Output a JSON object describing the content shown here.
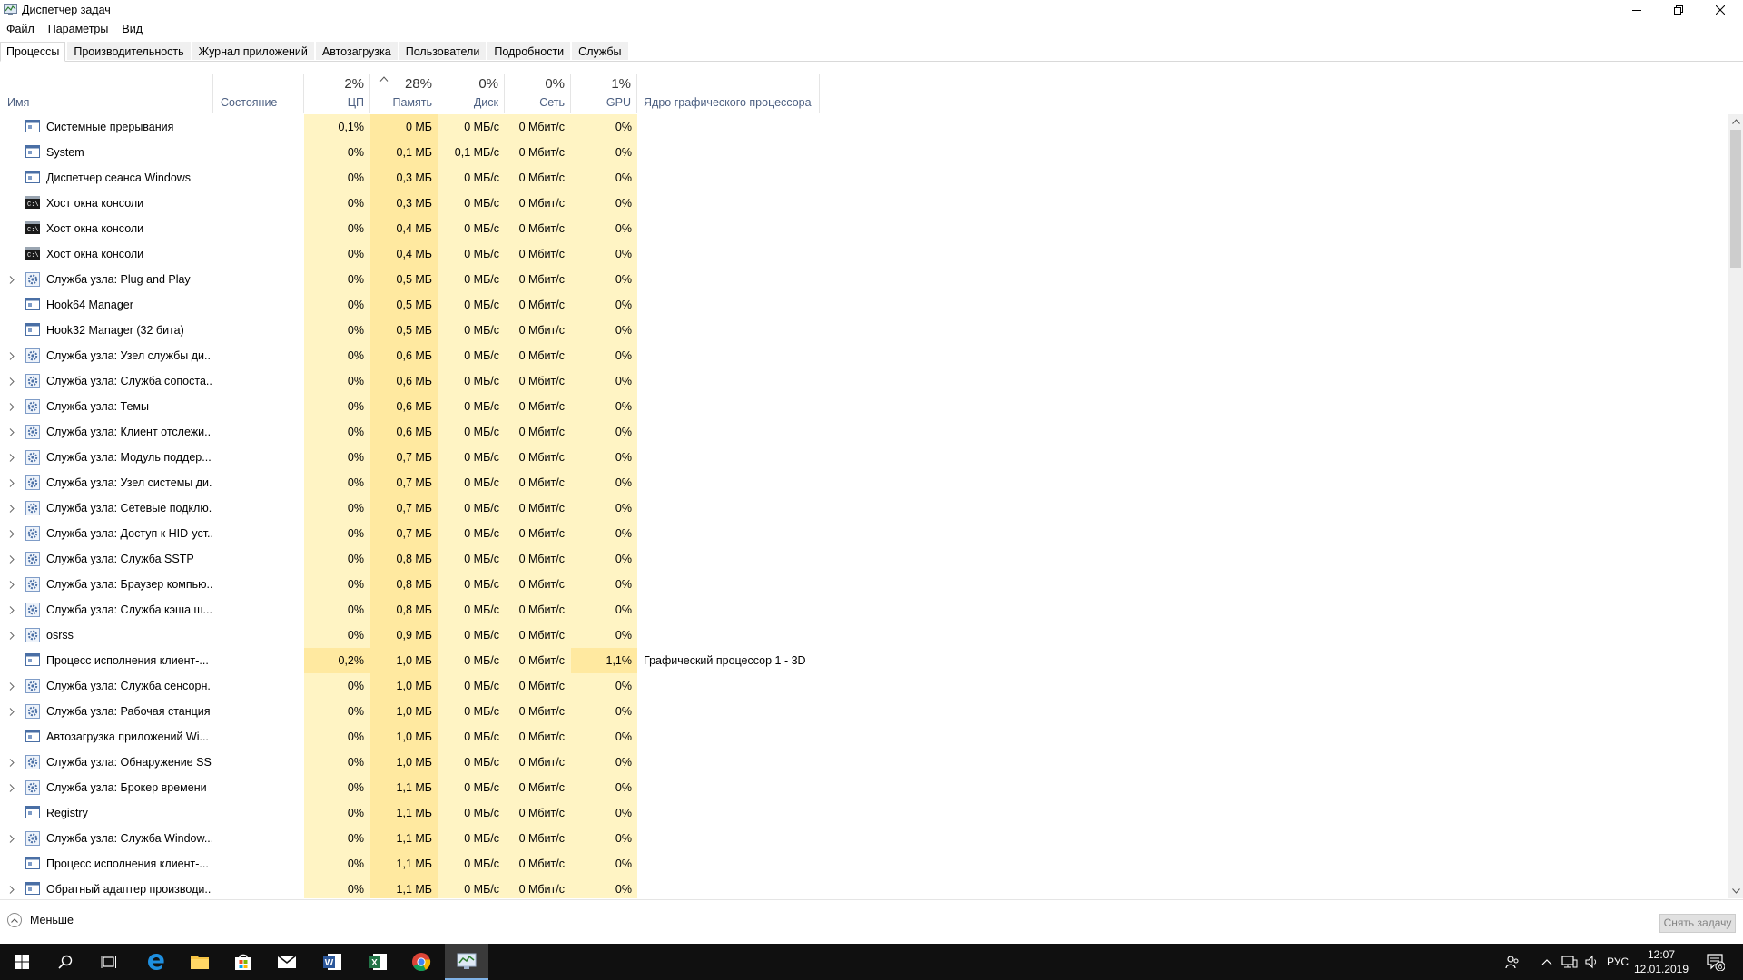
{
  "window": {
    "title": "Диспетчер задач",
    "minimize_icon": "minimize-icon",
    "maximize_icon": "restore-icon",
    "close_icon": "close-icon"
  },
  "menu": [
    "Файл",
    "Параметры",
    "Вид"
  ],
  "tabs": [
    "Процессы",
    "Производительность",
    "Журнал приложений",
    "Автозагрузка",
    "Пользователи",
    "Подробности",
    "Службы"
  ],
  "active_tab": "Процессы",
  "header": {
    "name": "Имя",
    "state": "Состояние",
    "cpu_pct": "2%",
    "cpu": "ЦП",
    "mem_pct": "28%",
    "mem": "Память",
    "disk_pct": "0%",
    "disk": "Диск",
    "net_pct": "0%",
    "net": "Сеть",
    "gpu_pct": "1%",
    "gpu": "GPU",
    "gpu_engine": "Ядро графического процессора"
  },
  "colors": {
    "heat_light": "#fff4c4",
    "heat_medium": "#ffe9a0",
    "header_label": "#4d6082",
    "taskbar": "#101010"
  },
  "processes": [
    {
      "name": "Системные прерывания",
      "icon": "app-window-icon",
      "expandable": false,
      "cpu": "0,1%",
      "mem": "0 МБ",
      "disk": "0 МБ/с",
      "net": "0 Мбит/с",
      "gpu": "0%",
      "engine": ""
    },
    {
      "name": "System",
      "icon": "app-window-icon",
      "expandable": false,
      "cpu": "0%",
      "mem": "0,1 МБ",
      "disk": "0,1 МБ/с",
      "net": "0 Мбит/с",
      "gpu": "0%",
      "engine": ""
    },
    {
      "name": "Диспетчер сеанса  Windows",
      "icon": "app-window-icon",
      "expandable": false,
      "cpu": "0%",
      "mem": "0,3 МБ",
      "disk": "0 МБ/с",
      "net": "0 Мбит/с",
      "gpu": "0%",
      "engine": ""
    },
    {
      "name": "Хост окна консоли",
      "icon": "console-icon",
      "expandable": false,
      "cpu": "0%",
      "mem": "0,3 МБ",
      "disk": "0 МБ/с",
      "net": "0 Мбит/с",
      "gpu": "0%",
      "engine": ""
    },
    {
      "name": "Хост окна консоли",
      "icon": "console-icon",
      "expandable": false,
      "cpu": "0%",
      "mem": "0,4 МБ",
      "disk": "0 МБ/с",
      "net": "0 Мбит/с",
      "gpu": "0%",
      "engine": ""
    },
    {
      "name": "Хост окна консоли",
      "icon": "console-icon",
      "expandable": false,
      "cpu": "0%",
      "mem": "0,4 МБ",
      "disk": "0 МБ/с",
      "net": "0 Мбит/с",
      "gpu": "0%",
      "engine": ""
    },
    {
      "name": "Служба узла: Plug and Play",
      "icon": "service-gear-icon",
      "expandable": true,
      "cpu": "0%",
      "mem": "0,5 МБ",
      "disk": "0 МБ/с",
      "net": "0 Мбит/с",
      "gpu": "0%",
      "engine": ""
    },
    {
      "name": "Hook64 Manager",
      "icon": "app-window-icon",
      "expandable": false,
      "cpu": "0%",
      "mem": "0,5 МБ",
      "disk": "0 МБ/с",
      "net": "0 Мбит/с",
      "gpu": "0%",
      "engine": ""
    },
    {
      "name": "Hook32 Manager (32 бита)",
      "icon": "app-window-icon",
      "expandable": false,
      "cpu": "0%",
      "mem": "0,5 МБ",
      "disk": "0 МБ/с",
      "net": "0 Мбит/с",
      "gpu": "0%",
      "engine": ""
    },
    {
      "name": "Служба узла: Узел службы ди...",
      "icon": "service-gear-icon",
      "expandable": true,
      "cpu": "0%",
      "mem": "0,6 МБ",
      "disk": "0 МБ/с",
      "net": "0 Мбит/с",
      "gpu": "0%",
      "engine": ""
    },
    {
      "name": "Служба узла: Служба сопоста...",
      "icon": "service-gear-icon",
      "expandable": true,
      "cpu": "0%",
      "mem": "0,6 МБ",
      "disk": "0 МБ/с",
      "net": "0 Мбит/с",
      "gpu": "0%",
      "engine": ""
    },
    {
      "name": "Служба узла: Темы",
      "icon": "service-gear-icon",
      "expandable": true,
      "cpu": "0%",
      "mem": "0,6 МБ",
      "disk": "0 МБ/с",
      "net": "0 Мбит/с",
      "gpu": "0%",
      "engine": ""
    },
    {
      "name": "Служба узла: Клиент отслежи...",
      "icon": "service-gear-icon",
      "expandable": true,
      "cpu": "0%",
      "mem": "0,6 МБ",
      "disk": "0 МБ/с",
      "net": "0 Мбит/с",
      "gpu": "0%",
      "engine": ""
    },
    {
      "name": "Служба узла: Модуль поддер...",
      "icon": "service-gear-icon",
      "expandable": true,
      "cpu": "0%",
      "mem": "0,7 МБ",
      "disk": "0 МБ/с",
      "net": "0 Мбит/с",
      "gpu": "0%",
      "engine": ""
    },
    {
      "name": "Служба узла: Узел системы ди...",
      "icon": "service-gear-icon",
      "expandable": true,
      "cpu": "0%",
      "mem": "0,7 МБ",
      "disk": "0 МБ/с",
      "net": "0 Мбит/с",
      "gpu": "0%",
      "engine": ""
    },
    {
      "name": "Служба узла: Сетевые подклю...",
      "icon": "service-gear-icon",
      "expandable": true,
      "cpu": "0%",
      "mem": "0,7 МБ",
      "disk": "0 МБ/с",
      "net": "0 Мбит/с",
      "gpu": "0%",
      "engine": ""
    },
    {
      "name": "Служба узла: Доступ к HID-уст...",
      "icon": "service-gear-icon",
      "expandable": true,
      "cpu": "0%",
      "mem": "0,7 МБ",
      "disk": "0 МБ/с",
      "net": "0 Мбит/с",
      "gpu": "0%",
      "engine": ""
    },
    {
      "name": "Служба узла: Служба SSTP",
      "icon": "service-gear-icon",
      "expandable": true,
      "cpu": "0%",
      "mem": "0,8 МБ",
      "disk": "0 МБ/с",
      "net": "0 Мбит/с",
      "gpu": "0%",
      "engine": ""
    },
    {
      "name": "Служба узла: Браузер компью...",
      "icon": "service-gear-icon",
      "expandable": true,
      "cpu": "0%",
      "mem": "0,8 МБ",
      "disk": "0 МБ/с",
      "net": "0 Мбит/с",
      "gpu": "0%",
      "engine": ""
    },
    {
      "name": "Служба узла: Служба кэша ш...",
      "icon": "service-gear-icon",
      "expandable": true,
      "cpu": "0%",
      "mem": "0,8 МБ",
      "disk": "0 МБ/с",
      "net": "0 Мбит/с",
      "gpu": "0%",
      "engine": ""
    },
    {
      "name": "osrss",
      "icon": "service-gear-icon",
      "expandable": true,
      "cpu": "0%",
      "mem": "0,9 МБ",
      "disk": "0 МБ/с",
      "net": "0 Мбит/с",
      "gpu": "0%",
      "engine": ""
    },
    {
      "name": "Процесс исполнения клиент-...",
      "icon": "app-window-icon",
      "expandable": false,
      "cpu": "0,2%",
      "mem": "1,0 МБ",
      "disk": "0 МБ/с",
      "net": "0 Мбит/с",
      "gpu": "1,1%",
      "engine": "Графический процессор 1 - 3D",
      "highlight": true
    },
    {
      "name": "Служба узла: Служба сенсорн...",
      "icon": "service-gear-icon",
      "expandable": true,
      "cpu": "0%",
      "mem": "1,0 МБ",
      "disk": "0 МБ/с",
      "net": "0 Мбит/с",
      "gpu": "0%",
      "engine": ""
    },
    {
      "name": "Служба узла: Рабочая станция",
      "icon": "service-gear-icon",
      "expandable": true,
      "cpu": "0%",
      "mem": "1,0 МБ",
      "disk": "0 МБ/с",
      "net": "0 Мбит/с",
      "gpu": "0%",
      "engine": ""
    },
    {
      "name": "Автозагрузка приложений Wi...",
      "icon": "app-window-icon",
      "expandable": false,
      "cpu": "0%",
      "mem": "1,0 МБ",
      "disk": "0 МБ/с",
      "net": "0 Мбит/с",
      "gpu": "0%",
      "engine": ""
    },
    {
      "name": "Служба узла: Обнаружение SS...",
      "icon": "service-gear-icon",
      "expandable": true,
      "cpu": "0%",
      "mem": "1,0 МБ",
      "disk": "0 МБ/с",
      "net": "0 Мбит/с",
      "gpu": "0%",
      "engine": ""
    },
    {
      "name": "Служба узла: Брокер времени",
      "icon": "service-gear-icon",
      "expandable": true,
      "cpu": "0%",
      "mem": "1,1 МБ",
      "disk": "0 МБ/с",
      "net": "0 Мбит/с",
      "gpu": "0%",
      "engine": ""
    },
    {
      "name": "Registry",
      "icon": "app-window-icon",
      "expandable": false,
      "cpu": "0%",
      "mem": "1,1 МБ",
      "disk": "0 МБ/с",
      "net": "0 Мбит/с",
      "gpu": "0%",
      "engine": ""
    },
    {
      "name": "Служба узла: Служба Window...",
      "icon": "service-gear-icon",
      "expandable": true,
      "cpu": "0%",
      "mem": "1,1 МБ",
      "disk": "0 МБ/с",
      "net": "0 Мбит/с",
      "gpu": "0%",
      "engine": ""
    },
    {
      "name": "Процесс исполнения клиент-...",
      "icon": "app-window-icon",
      "expandable": false,
      "cpu": "0%",
      "mem": "1,1 МБ",
      "disk": "0 МБ/с",
      "net": "0 Мбит/с",
      "gpu": "0%",
      "engine": ""
    },
    {
      "name": "Обратный адаптер производи...",
      "icon": "app-window-icon",
      "expandable": true,
      "cpu": "0%",
      "mem": "1,1 МБ",
      "disk": "0 МБ/с",
      "net": "0 Мбит/с",
      "gpu": "0%",
      "engine": ""
    }
  ],
  "footer": {
    "less_label": "Меньше",
    "end_task_label": "Снять задачу"
  },
  "taskbar": {
    "apps": [
      "start-windows-icon",
      "search-icon",
      "task-view-icon",
      "edge-icon",
      "file-explorer-icon",
      "store-icon",
      "mail-icon",
      "word-icon",
      "excel-icon",
      "chrome-icon",
      "task-manager-icon"
    ],
    "language": "РУС",
    "time": "12:07",
    "date": "12.01.2019",
    "notifications_count": "6"
  }
}
